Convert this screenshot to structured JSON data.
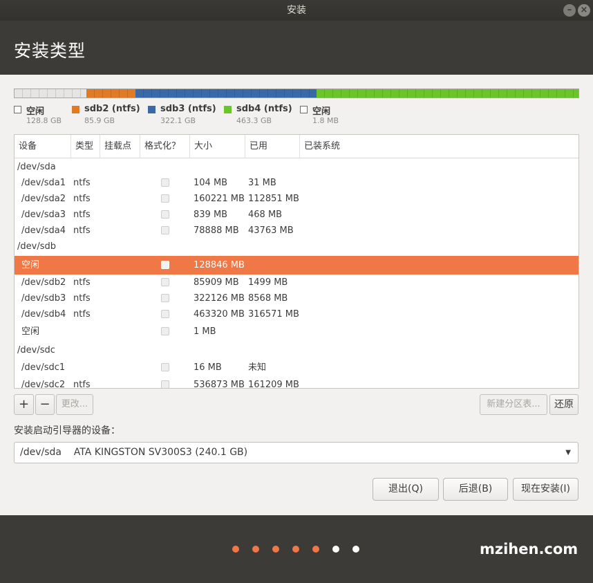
{
  "window": {
    "title": "安装",
    "minimize_label": "–",
    "close_label": "×"
  },
  "header": {
    "title": "安装类型"
  },
  "usage_bar": {
    "segments": [
      {
        "color": "#e6e5e3",
        "fraction": 0.128
      },
      {
        "color": "#e07a25",
        "fraction": 0.086
      },
      {
        "color": "#3a69a7",
        "fraction": 0.322
      },
      {
        "color": "#6ac52a",
        "fraction": 0.464
      }
    ]
  },
  "legend": [
    {
      "name": "空闲",
      "size": "128.8 GB",
      "color": "#ffffff"
    },
    {
      "name": "sdb2 (ntfs)",
      "size": "85.9 GB",
      "color": "#e07a25"
    },
    {
      "name": "sdb3 (ntfs)",
      "size": "322.1 GB",
      "color": "#3a69a7"
    },
    {
      "name": "sdb4 (ntfs)",
      "size": "463.3 GB",
      "color": "#6ac52a"
    },
    {
      "name": "空闲",
      "size": "1.8 MB",
      "color": "#ffffff"
    }
  ],
  "table": {
    "headers": [
      "设备",
      "类型",
      "挂载点",
      "格式化？",
      "大小",
      "已用",
      "已装系统"
    ],
    "rows": [
      {
        "device": "/dev/sda",
        "group": true
      },
      {
        "device": "/dev/sda1",
        "type": "ntfs",
        "size": "104 MB",
        "used": "31 MB"
      },
      {
        "device": "/dev/sda2",
        "type": "ntfs",
        "size": "160221 MB",
        "used": "112851 MB"
      },
      {
        "device": "/dev/sda3",
        "type": "ntfs",
        "size": "839 MB",
        "used": "468 MB"
      },
      {
        "device": "/dev/sda4",
        "type": "ntfs",
        "size": "78888 MB",
        "used": "43763 MB"
      },
      {
        "device": "/dev/sdb",
        "group": true
      },
      {
        "device": "空闲",
        "type": "",
        "size": "128846 MB",
        "used": "",
        "selected": true
      },
      {
        "device": "/dev/sdb2",
        "type": "ntfs",
        "size": "85909 MB",
        "used": "1499 MB"
      },
      {
        "device": "/dev/sdb3",
        "type": "ntfs",
        "size": "322126 MB",
        "used": "8568 MB"
      },
      {
        "device": "/dev/sdb4",
        "type": "ntfs",
        "size": "463320 MB",
        "used": "316571 MB"
      },
      {
        "device": "空闲",
        "type": "",
        "size": "1 MB",
        "used": ""
      },
      {
        "device": "/dev/sdc",
        "group": true
      },
      {
        "device": "/dev/sdc1",
        "type": "",
        "size": "16 MB",
        "used": "未知"
      },
      {
        "device": "/dev/sdc2",
        "type": "ntfs",
        "size": "536873 MB",
        "used": "161209 MB"
      }
    ]
  },
  "toolbar": {
    "add_label": "+",
    "remove_label": "−",
    "change_label": "更改...",
    "new_table_label": "新建分区表...",
    "revert_label": "还原"
  },
  "bootloader": {
    "label": "安装启动引导器的设备：",
    "selected": "/dev/sda    ATA KINGSTON SV300S3 (240.1 GB)"
  },
  "buttons": {
    "quit": "退出(Q)",
    "back": "后退(B)",
    "install": "现在安装(I)"
  },
  "progress": {
    "total": 7,
    "completed": 5,
    "active_color": "#f07746",
    "inactive_color": "#ffffff"
  },
  "watermark": "mzihen.com"
}
